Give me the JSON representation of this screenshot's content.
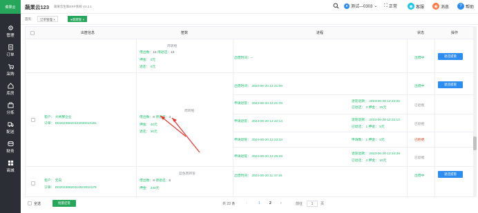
{
  "sidebar": {
    "logo": "菜果云",
    "items": [
      {
        "label": "管理",
        "icon": "gear-icon"
      },
      {
        "label": "订单",
        "icon": "document-icon"
      },
      {
        "label": "采购",
        "icon": "cart-icon"
      },
      {
        "label": "库房",
        "icon": "warehouse-icon"
      },
      {
        "label": "分拣",
        "icon": "sort-icon"
      },
      {
        "label": "配送",
        "icon": "truck-icon"
      },
      {
        "label": "财务",
        "icon": "coins-icon"
      },
      {
        "label": "商城",
        "icon": "grid-icon"
      }
    ]
  },
  "header": {
    "title": "蔬果云123",
    "subtitle": "蔬果云生鲜ERP系统 V3.2.1",
    "user": "测试—0303",
    "fullscreen": "正常",
    "service": "客服",
    "message": "消息",
    "help": "帮助"
  },
  "tabs": {
    "home": "首页",
    "order": "订单管理",
    "active": "●周转筐"
  },
  "table": {
    "headers": [
      "出筐信息",
      "筐数",
      "进程",
      "状态",
      "操作"
    ],
    "row1": {
      "basket_name": "周转框",
      "out_label": "借出数：",
      "out_val": "15",
      "ret_label": "待退还：",
      "ret_val": "15",
      "deposit": "押金： 0元",
      "refund": "退还： 0元",
      "progress": "出借时间：--",
      "status": "出借中",
      "action": "退还提管"
    },
    "row2": {
      "customer": "客户： 大闸蟹企业",
      "order": "订单： DD20230620122030010181",
      "basket_name": "周转框",
      "out_label": "借出数：",
      "out_val": "8",
      "ret_label": "待退还：",
      "ret_val": "3",
      "deposit": "押金： 40元",
      "refund": "退还： 30元",
      "sub": [
        {
          "left": "出借时间： 2023-06-20 12:21:09",
          "right_a": "",
          "right_b": "",
          "status": "出借中",
          "status_color": "green",
          "action": "退还提管"
        },
        {
          "left": "申请退筐： 2023-06-20 12:21:29",
          "right_a": "退筐退款： 2023-06-20 12:22:06",
          "right_b": "已退还： 3   押金： 15元",
          "status": "已退框",
          "status_color": "gray",
          "action": ""
        },
        {
          "left": "申请退筐： 2023-06-20 12:22:13",
          "right_a": "退筐退款： 2023-06-20 12:22:13",
          "right_b": "已退还： 1   押金： 5元",
          "status": "已退框",
          "status_color": "gray",
          "action": ""
        },
        {
          "left": "申请退筐： 2023-06-20 12:22:33",
          "right_a": "申请数： 1   押金： 5元",
          "right_b": "",
          "status": "已拒绝",
          "status_color": "red",
          "action": ""
        },
        {
          "left": "申请退筐： 2023-06-20 12:25:29",
          "right_a": "退筐退款： 2023-06-20 12:34:38",
          "right_b": "已退还： 2   押金： 10元",
          "status": "已退框",
          "status_color": "gray",
          "action": ""
        }
      ]
    },
    "row3": {
      "customer": "客户： 无向",
      "order": "订单： DD20230620114523010178",
      "basket_name": "蓝色周转筐",
      "out_label": "借出数：",
      "out_val": "8",
      "ret_label": "待退还：",
      "ret_val": "8",
      "deposit": "押金： 240元",
      "progress": "出借时间： 2023-06-20 11:47:16",
      "status": "出借中",
      "action": "退还提管"
    }
  },
  "footer": {
    "select_all": "全选",
    "batch": "批量还筐",
    "total": "共 23 条",
    "page1": "1",
    "page2": "2",
    "goto": "前往",
    "goto_val": "1",
    "page_unit": "页"
  }
}
